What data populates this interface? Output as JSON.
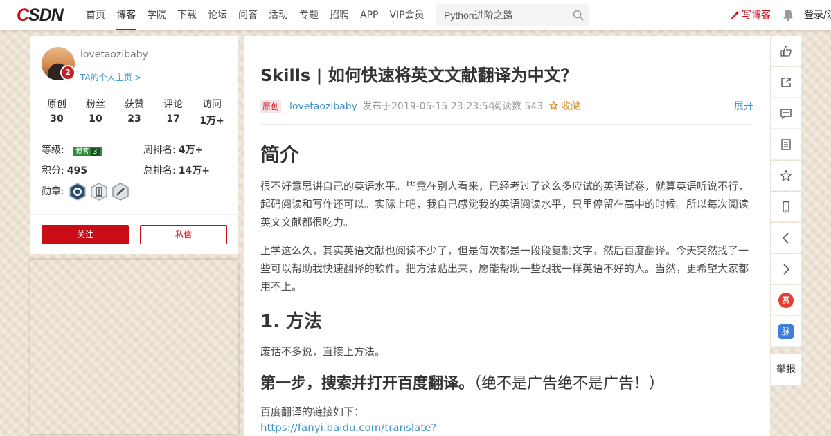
{
  "topbar": {
    "logo": "CSDN",
    "nav": [
      "首页",
      "博客",
      "学院",
      "下载",
      "论坛",
      "问答",
      "活动",
      "专题",
      "招聘",
      "APP",
      "VIP会员"
    ],
    "active_nav": "博客",
    "search_placeholder": "Python进阶之路",
    "write_label": "写博客",
    "login_label": "登录/注册",
    "brand_color": "#ca0c16"
  },
  "profile": {
    "username": "lovetaozibaby",
    "avatar_badge": "2",
    "homepage_link": "TA的个人主页 >",
    "stats": [
      {
        "label": "原创",
        "value": "30"
      },
      {
        "label": "粉丝",
        "value": "10"
      },
      {
        "label": "获赞",
        "value": "23"
      },
      {
        "label": "评论",
        "value": "17"
      },
      {
        "label": "访问",
        "value": "1万+"
      }
    ],
    "level_label": "等级:",
    "level_badge": "博客",
    "level_value": "3",
    "weekly_rank_label": "周排名:",
    "weekly_rank": "4万+",
    "points_label": "积分:",
    "points": "495",
    "total_rank_label": "总排名:",
    "total_rank": "14万+",
    "medals_label": "勋章:",
    "medals": [
      "github-medal-icon",
      "persistence-medal-icon",
      "blogger-medal-icon"
    ],
    "follow_label": "关注",
    "message_label": "私信"
  },
  "article": {
    "title": "Skills | 如何快速将英文文献翻译为中文？",
    "tag": "原创",
    "author": "lovetaozibaby",
    "published": "发布于2019-05-15 23:23:54",
    "reads": "阅读数 543",
    "favorite": "收藏",
    "expand": "展开",
    "h_intro": "简介",
    "p1": "很不好意思讲自己的英语水平。毕竟在别人看来，已经考过了这么多应试的英语试卷，就算英语听说不行，起码阅读和写作还可以。实际上吧，我自己感觉我的英语阅读水平，只里停留在高中的时候。所以每次阅读英文文献都很吃力。",
    "p2": "上学这么久，其实英语文献也阅读不少了，但是每次都是一段段复制文字，然后百度翻译。今天突然找了一些可以帮助我快速翻译的软件。把方法贴出来，愿能帮助一些跟我一样英语不好的人。当然，更希望大家都用不上。",
    "h_method": "1. 方法",
    "p3": "废话不多说，直接上方法。",
    "step1": "第一步，搜索并打开百度翻译。",
    "step1_note": "（绝不是广告绝不是广告！）",
    "p4": "百度翻译的链接如下：",
    "link": "https://fanyi.baidu.com/translate?"
  },
  "toolbar": {
    "items": [
      "like-icon",
      "share-icon",
      "comment-icon",
      "catalog-icon",
      "star-icon",
      "mobile-icon",
      "prev-icon",
      "next-icon",
      "reward-icon",
      "connections-icon"
    ],
    "reward_label": "赏",
    "connections_label": "脉",
    "report_label": "举报",
    "reward_color": "#e33e33",
    "connections_color": "#3f7fd8"
  }
}
